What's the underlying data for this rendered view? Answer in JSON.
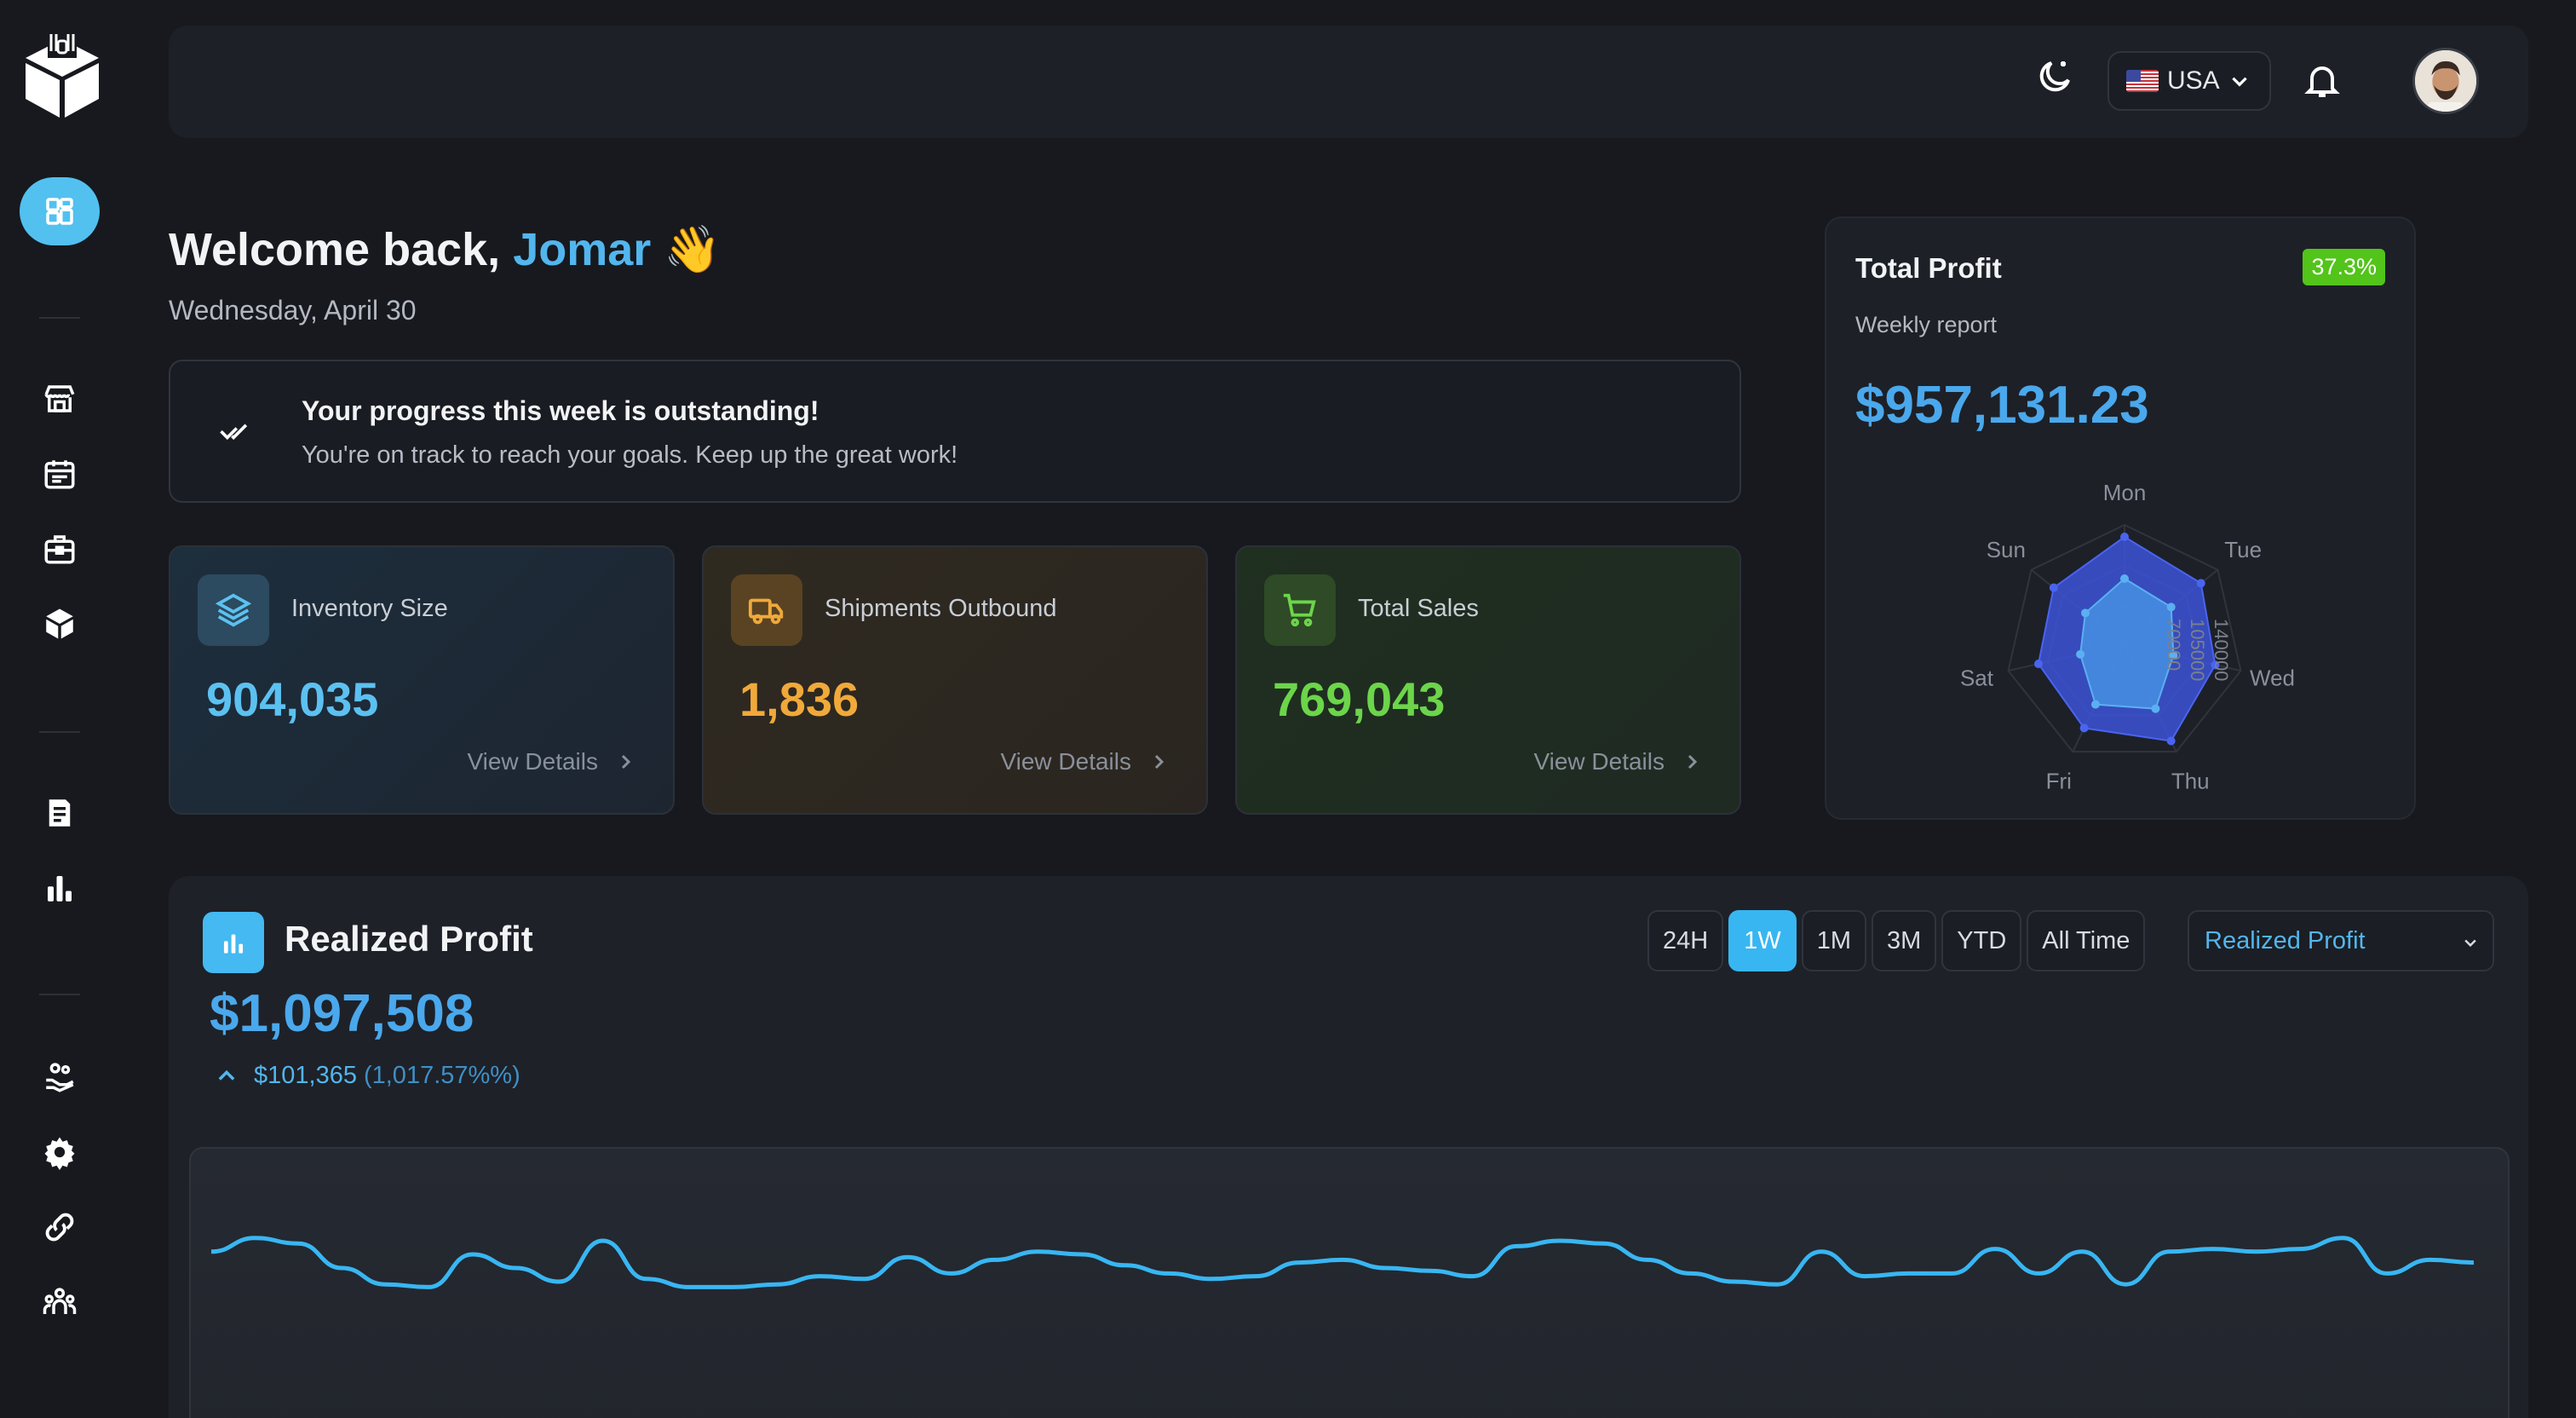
{
  "sidebar": {
    "items": [
      "dashboard-icon",
      "store-icon",
      "calendar-icon",
      "briefcase-icon",
      "box-icon",
      "report-icon",
      "bar-chart-icon",
      "handshake-icon",
      "gear-icon",
      "link-icon",
      "team-icon"
    ]
  },
  "topbar": {
    "country": "USA"
  },
  "welcome": {
    "greeting": "Welcome back,",
    "name": "Jomar",
    "emoji": "👋",
    "date": "Wednesday, April 30"
  },
  "progress": {
    "title": "Your progress this week is outstanding!",
    "text": "You're on track to reach your goals. Keep up the great work!"
  },
  "stats": [
    {
      "label": "Inventory Size",
      "value": "904,035",
      "link": "View Details",
      "color": "#5cc1f0"
    },
    {
      "label": "Shipments Outbound",
      "value": "1,836",
      "link": "View Details",
      "color": "#f0a93a"
    },
    {
      "label": "Total Sales",
      "value": "769,043",
      "link": "View Details",
      "color": "#6cd54a"
    }
  ],
  "total_profit": {
    "title": "Total Profit",
    "badge": "37.3%",
    "subtitle": "Weekly report",
    "amount": "$957,131.23",
    "radar": {
      "axes": [
        "Mon",
        "Tue",
        "Wed",
        "Thu",
        "Fri",
        "Sat",
        "Sun"
      ],
      "ticks": [
        "70000",
        "105000",
        "140000"
      ],
      "series": [
        {
          "values": [
            0.9,
            0.82,
            0.78,
            0.9,
            0.78,
            0.74,
            0.76
          ]
        },
        {
          "values": [
            0.55,
            0.5,
            0.42,
            0.6,
            0.56,
            0.38,
            0.42
          ]
        }
      ]
    }
  },
  "realized": {
    "title": "Realized Profit",
    "value": "$1,097,508",
    "change": "$101,365",
    "change_pct": "(1,017.57%%)",
    "ranges": [
      "24H",
      "1W",
      "1M",
      "3M",
      "YTD",
      "All Time"
    ],
    "active_range": "1W",
    "metric": "Realized Profit"
  },
  "chart_data": {
    "type": "line",
    "series": [
      {
        "values": [
          0.62,
          0.72,
          0.68,
          0.5,
          0.38,
          0.36,
          0.6,
          0.5,
          0.4,
          0.7,
          0.42,
          0.36,
          0.36,
          0.38,
          0.44,
          0.42,
          0.58,
          0.46,
          0.56,
          0.62,
          0.6,
          0.52,
          0.46,
          0.42,
          0.44,
          0.54,
          0.56,
          0.5,
          0.48,
          0.44,
          0.66,
          0.7,
          0.68,
          0.56,
          0.46,
          0.4,
          0.38,
          0.62,
          0.44,
          0.46,
          0.46,
          0.64,
          0.46,
          0.62,
          0.38,
          0.62,
          0.64,
          0.62,
          0.64,
          0.72,
          0.46,
          0.56,
          0.54
        ]
      }
    ],
    "color": "#38b6f2"
  }
}
